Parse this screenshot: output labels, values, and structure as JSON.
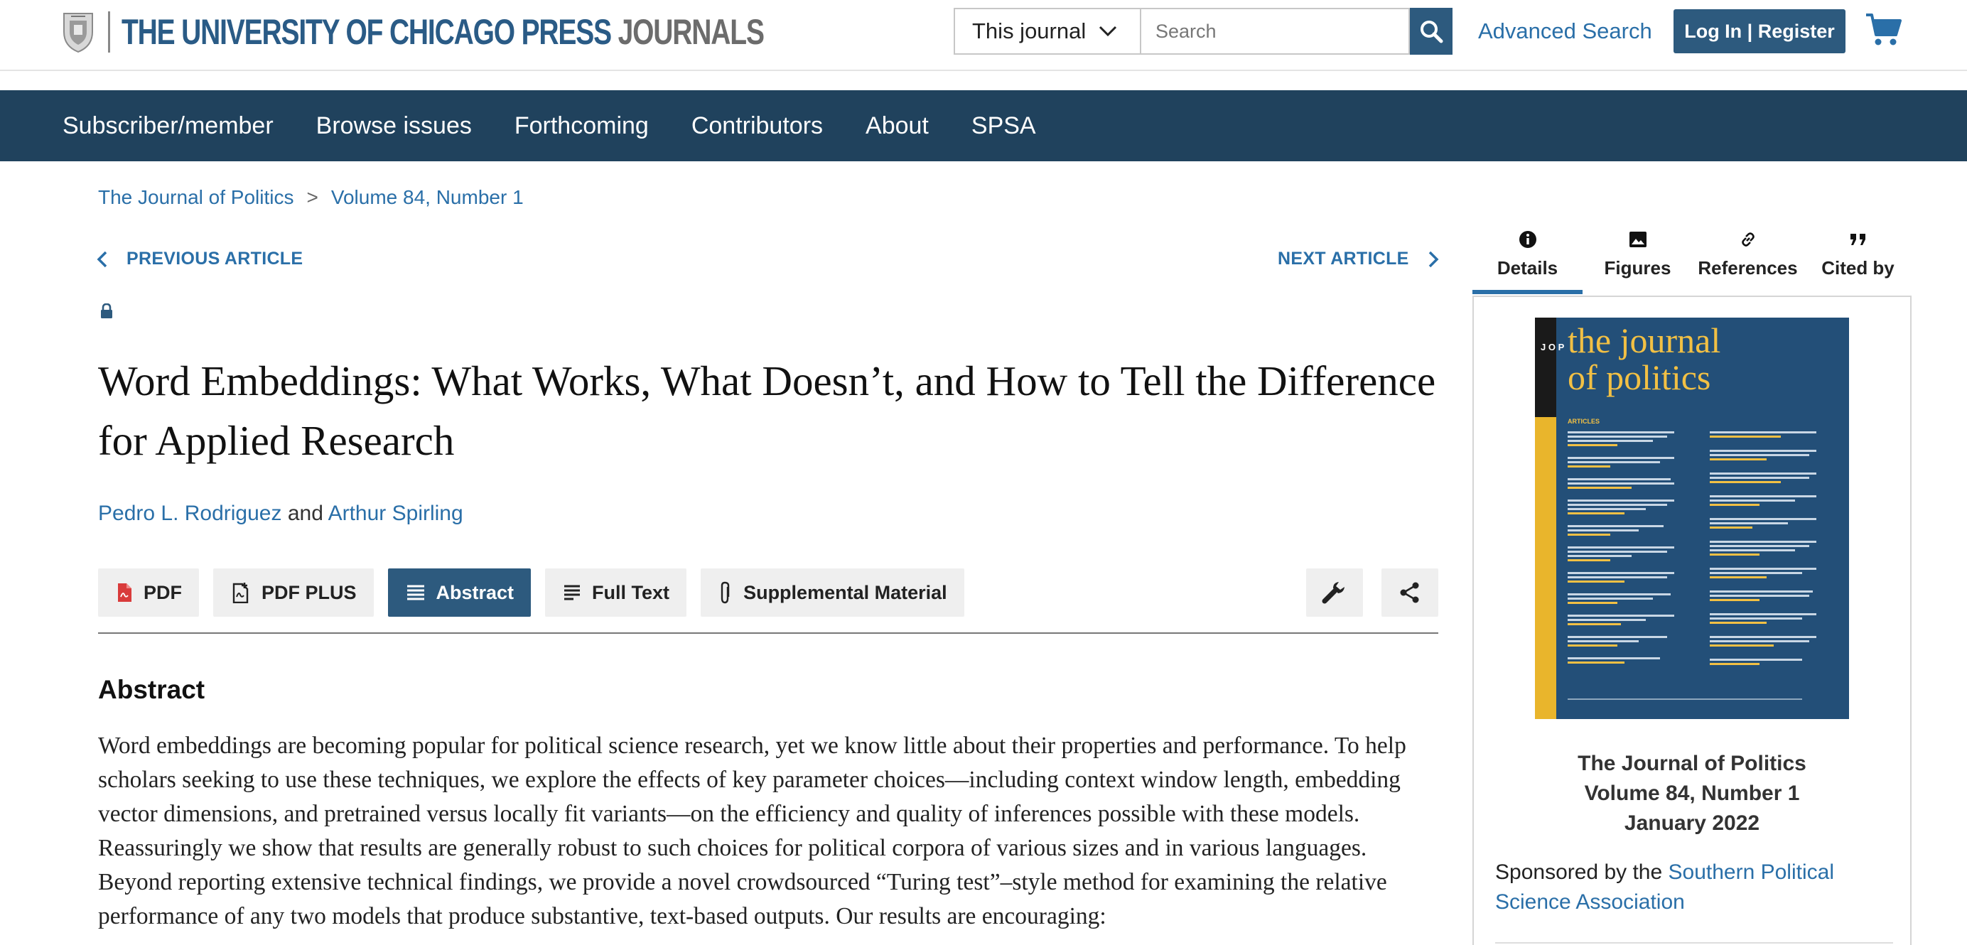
{
  "header": {
    "logo_part1": "THE UNIVERSITY OF CHICAGO PRESS",
    "logo_part2": "JOURNALS",
    "scope_select": "This journal",
    "search_placeholder": "Search",
    "advanced_search": "Advanced Search",
    "login": "Log In | Register",
    "icons": [
      "university-seal-icon",
      "chevron-down-icon",
      "search-icon",
      "cart-icon"
    ]
  },
  "nav": {
    "items": [
      "Subscriber/member",
      "Browse issues",
      "Forthcoming",
      "Contributors",
      "About",
      "SPSA"
    ]
  },
  "breadcrumb": {
    "journal": "The Journal of Politics",
    "separator": ">",
    "issue": "Volume 84, Number 1"
  },
  "article_nav": {
    "previous": "PREVIOUS ARTICLE",
    "next": "NEXT ARTICLE"
  },
  "article": {
    "title": "Word Embeddings: What Works, What Doesn’t, and How to Tell the Difference for Applied Research",
    "author1": "Pedro L. Rodriguez",
    "and": "and",
    "author2": "Arthur Spirling"
  },
  "toolbar": {
    "pdf": "PDF",
    "pdf_plus": "PDF PLUS",
    "abstract": "Abstract",
    "full_text": "Full Text",
    "supplemental": "Supplemental Material",
    "active": "Abstract"
  },
  "abstract": {
    "heading": "Abstract",
    "text": "Word embeddings are becoming popular for political science research, yet we know little about their properties and performance. To help scholars seeking to use these techniques, we explore the effects of key parameter choices—including context window length, embedding vector dimensions, and pretrained versus locally fit variants—on the efficiency and quality of inferences possible with these models. Reassuringly we show that results are generally robust to such choices for political corpora of various sizes and in various languages. Beyond reporting extensive technical findings, we provide a novel crowdsourced “Turing test”–style method for examining the relative performance of any two models that produce substantive, text-based outputs. Our results are encouraging:"
  },
  "sidebar": {
    "tabs": [
      "Details",
      "Figures",
      "References",
      "Cited by"
    ],
    "active_tab": "Details",
    "cover": {
      "title_line1": "the journal",
      "title_line2": "of politics",
      "spine": "J O P",
      "section": "ARTICLES"
    },
    "journal_name": "The Journal of Politics",
    "volume": "Volume 84, Number 1",
    "date": "January 2022",
    "sponsor_prefix": "Sponsored by the",
    "sponsor_link": "Southern Political Science Association"
  },
  "colors": {
    "nav_bg": "#20425d",
    "primary_button": "#2d5a7e",
    "link": "#2a6fa8",
    "cover_bg": "#234f78",
    "cover_accent": "#f2c044"
  }
}
